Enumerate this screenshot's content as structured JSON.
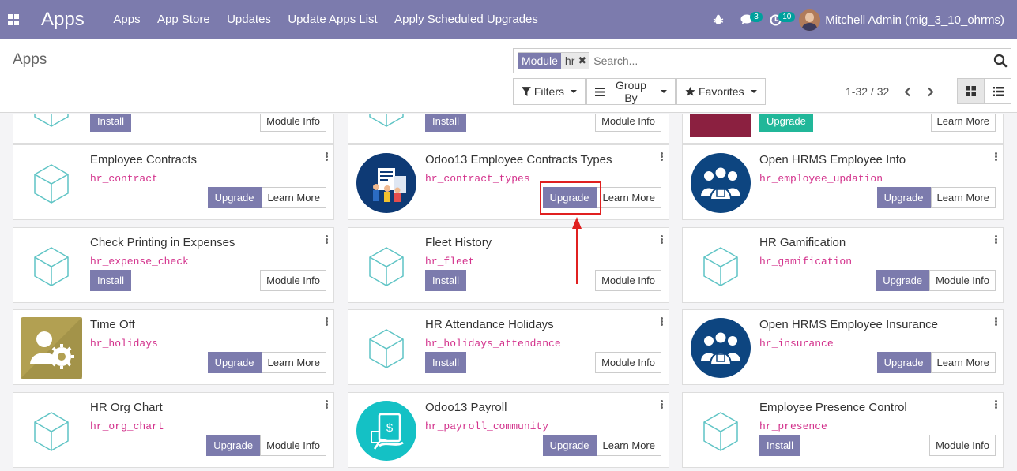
{
  "navbar": {
    "brand": "Apps",
    "menu": [
      "Apps",
      "App Store",
      "Updates",
      "Update Apps List",
      "Apply Scheduled Upgrades"
    ],
    "messages_count": "3",
    "activities_count": "10",
    "user_name": "Mitchell Admin (mig_3_10_ohrms)"
  },
  "control_panel": {
    "breadcrumb": "Apps",
    "facet_category": "Module",
    "facet_value": "hr",
    "search_placeholder": "Search...",
    "filters_label": "Filters",
    "groupby_label": "Group By",
    "favorites_label": "Favorites",
    "pager": "1-32 / 32"
  },
  "partial_row": [
    {
      "button": "Install",
      "secondary": "Module Info"
    },
    {
      "button": "Install",
      "secondary": "Module Info"
    },
    {
      "button": "Upgrade",
      "secondary": "Learn More"
    }
  ],
  "cards": [
    {
      "title": "Employee Contracts",
      "tech": "hr_contract",
      "button": "Upgrade",
      "secondary": "Learn More",
      "icon": "cube"
    },
    {
      "title": "Odoo13 Employee Contracts Types",
      "tech": "hr_contract_types",
      "button": "Upgrade",
      "secondary": "Learn More",
      "icon": "contracts"
    },
    {
      "title": "Open HRMS Employee Info",
      "tech": "hr_employee_updation",
      "button": "Upgrade",
      "secondary": "Learn More",
      "icon": "people"
    },
    {
      "title": "Check Printing in Expenses",
      "tech": "hr_expense_check",
      "button": "Install",
      "secondary": "Module Info",
      "icon": "cube"
    },
    {
      "title": "Fleet History",
      "tech": "hr_fleet",
      "button": "Install",
      "secondary": "Module Info",
      "icon": "cube"
    },
    {
      "title": "HR Gamification",
      "tech": "hr_gamification",
      "button": "Upgrade",
      "secondary": "Module Info",
      "icon": "cube"
    },
    {
      "title": "Time Off",
      "tech": "hr_holidays",
      "button": "Upgrade",
      "secondary": "Learn More",
      "icon": "timeoff"
    },
    {
      "title": "HR Attendance Holidays",
      "tech": "hr_holidays_attendance",
      "button": "Install",
      "secondary": "Module Info",
      "icon": "cube"
    },
    {
      "title": "Open HRMS Employee Insurance",
      "tech": "hr_insurance",
      "button": "Upgrade",
      "secondary": "Learn More",
      "icon": "people"
    },
    {
      "title": "HR Org Chart",
      "tech": "hr_org_chart",
      "button": "Upgrade",
      "secondary": "Module Info",
      "icon": "cube"
    },
    {
      "title": "Odoo13 Payroll",
      "tech": "hr_payroll_community",
      "button": "Upgrade",
      "secondary": "Learn More",
      "icon": "payroll"
    },
    {
      "title": "Employee Presence Control",
      "tech": "hr_presence",
      "button": "Install",
      "secondary": "Module Info",
      "icon": "cube"
    }
  ]
}
